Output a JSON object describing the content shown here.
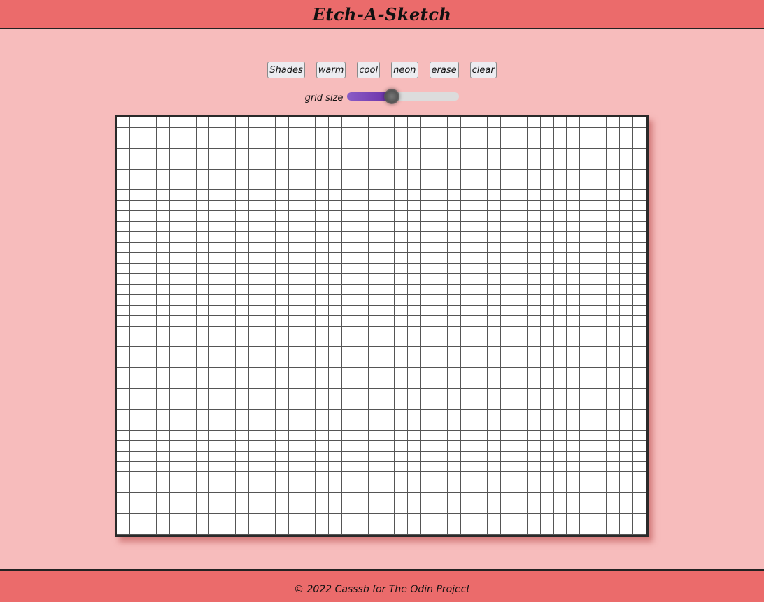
{
  "header": {
    "title": "Etch-A-Sketch"
  },
  "toolbar": {
    "buttons": [
      {
        "id": "shades",
        "label": "Shades"
      },
      {
        "id": "warm",
        "label": "warm"
      },
      {
        "id": "cool",
        "label": "cool"
      },
      {
        "id": "neon",
        "label": "neon"
      },
      {
        "id": "erase",
        "label": "erase"
      },
      {
        "id": "clear",
        "label": "clear"
      }
    ]
  },
  "grid_size": {
    "label": "grid size",
    "value_fraction": 0.4
  },
  "canvas": {
    "columns": 40,
    "rows": 40,
    "cell_color": "#ffffff",
    "line_color": "#555555"
  },
  "footer": {
    "text": "© 2022 Casssb for The Odin Project"
  },
  "colors": {
    "header_bg": "#eb6b6b",
    "page_bg": "#f7bcbc",
    "slider_fill": "#7b43b8"
  }
}
